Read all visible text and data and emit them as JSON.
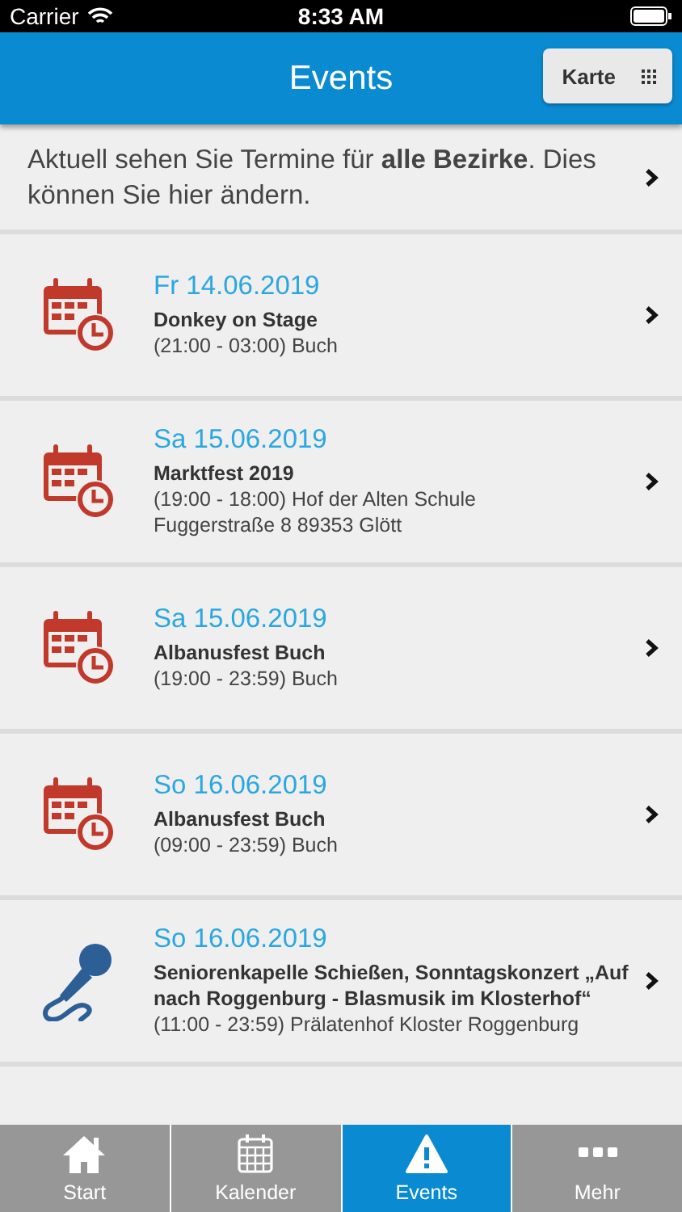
{
  "status_bar": {
    "carrier": "Carrier",
    "time": "8:33 AM"
  },
  "header": {
    "title": "Events",
    "map_button": "Karte"
  },
  "notice": "Aktuell sehen Sie Termine für **alle Bezirke**. Dies können Sie hier ändern.",
  "events": [
    {
      "kind": "calendar",
      "date": "Fr 14.06.2019",
      "title": "Donkey on Stage",
      "details": [
        "(21:00 - 03:00) Buch"
      ]
    },
    {
      "kind": "calendar",
      "date": "Sa 15.06.2019",
      "title": "Marktfest 2019",
      "details": [
        "(19:00 - 18:00) Hof der Alten Schule",
        "Fuggerstraße 8 89353 Glött"
      ]
    },
    {
      "kind": "calendar",
      "date": "Sa 15.06.2019",
      "title": "Albanusfest Buch",
      "details": [
        "(19:00 - 23:59) Buch"
      ]
    },
    {
      "kind": "calendar",
      "date": "So 16.06.2019",
      "title": "Albanusfest Buch",
      "details": [
        "(09:00 - 23:59) Buch"
      ]
    },
    {
      "kind": "microphone",
      "date": "So 16.06.2019",
      "title": "Seniorenkapelle Schießen, Sonntagskonzert „Auf nach Roggenburg - Blasmusik im Klosterhof“",
      "details": [
        "(11:00 - 23:59) Prälatenhof Kloster Roggenburg"
      ]
    }
  ],
  "tabs": [
    {
      "kind": "home",
      "label": "Start",
      "selected": false
    },
    {
      "kind": "calendar",
      "label": "Kalender",
      "selected": false
    },
    {
      "kind": "warning",
      "label": "Events",
      "selected": true
    },
    {
      "kind": "more",
      "label": "Mehr",
      "selected": false
    }
  ]
}
